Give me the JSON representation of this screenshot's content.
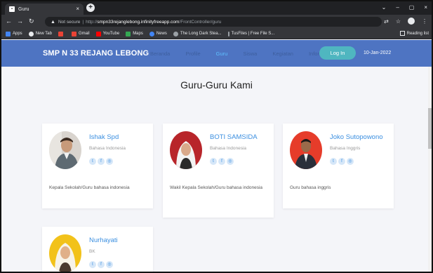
{
  "browser": {
    "tab_title": "Guru",
    "tab_close": "×",
    "new_tab": "+",
    "window_controls": [
      "⌄",
      "–",
      "▢",
      "×"
    ],
    "url_not_secure": "Not secure",
    "url_sep": "|",
    "url_host": "smpn33rejanglebong.infinityfreeapp.com",
    "url_path": "/FrontController/guru",
    "bookmarks": [
      {
        "label": "Apps",
        "color": "#4285f4"
      },
      {
        "label": "New Tab",
        "color": "#e8eaed"
      },
      {
        "label": "",
        "color": "#ea4335"
      },
      {
        "label": "Gmail",
        "color": "#ea4335"
      },
      {
        "label": "YouTube",
        "color": "#ff0000"
      },
      {
        "label": "Maps",
        "color": "#34a853"
      },
      {
        "label": "News",
        "color": "#4285f4"
      },
      {
        "label": "The Long Dark Stea...",
        "color": "#9aa0a6"
      },
      {
        "label": "TusFiles | Free File S...",
        "color": "#9aa0a6"
      }
    ],
    "reading_list": "Reading list"
  },
  "site": {
    "brand": "SMP N 33 REJANG LEBONG",
    "menu": [
      {
        "label": "Beranda",
        "active": false
      },
      {
        "label": "Profile",
        "active": false
      },
      {
        "label": "Guru",
        "active": true
      },
      {
        "label": "Siswa",
        "active": false
      },
      {
        "label": "Kegiatan",
        "active": false
      },
      {
        "label": "Informasi",
        "active": false
      }
    ],
    "login_label": "Log In",
    "date": "10-Jan-2022"
  },
  "main": {
    "title": "Guru-Guru Kami",
    "teachers": [
      {
        "name": "Ishak Spd",
        "subject": "Bahasa Indonesia",
        "desc": "Kepala Sekolah/Guru bahasa indonesia",
        "photo_bg": "#d9d4ce"
      },
      {
        "name": "BOTI SAMSIDA",
        "subject": "Bahasa Indonesia",
        "desc": "Wakil Kepala Sekolah/Guru bahasa indonesia",
        "photo_bg": "#b8252a"
      },
      {
        "name": "Joko Sutopowono",
        "subject": "Bahasa Inggris",
        "desc": "Guru bahasa inggris",
        "photo_bg": "#e63c2a"
      },
      {
        "name": "Nurhayati",
        "subject": "BK",
        "desc": "",
        "photo_bg": "#f2c21a"
      }
    ],
    "social_icons": [
      "twitter-icon",
      "facebook-icon",
      "instagram-icon"
    ]
  }
}
